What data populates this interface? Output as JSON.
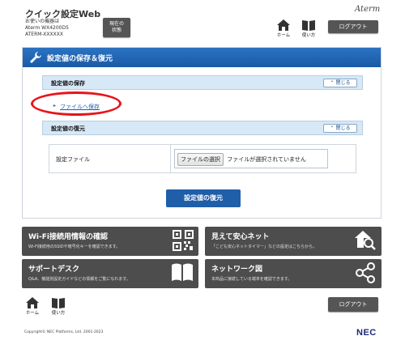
{
  "header": {
    "app_title": "クイック設定Web",
    "device_line1": "お使いの機器は",
    "device_line2": "Aterm  WX4200D5",
    "device_line3": "ATERM-XXXXXX",
    "status_button_line1": "現在の",
    "status_button_line2": "状態",
    "brand": "Aterm",
    "home_label": "ホーム",
    "usage_label": "使い方",
    "logout_label": "ログアウト"
  },
  "main": {
    "section_title": "設定値の保存＆復元",
    "save_section": {
      "label": "設定値の保存",
      "close_label": "閉じる",
      "link_text": "ファイルへ保存"
    },
    "restore_section": {
      "label": "設定値の復元",
      "close_label": "閉じる"
    },
    "file_row": {
      "label": "設定ファイル",
      "choose_button": "ファイルの選択",
      "status": "ファイルが選択されていません"
    },
    "restore_button": "設定値の復元"
  },
  "tiles": [
    {
      "title": "Wi-Fi接続用情報の確認",
      "desc": "Wi-Fi接続用のSSIDや暗号化キーを確認できます。",
      "icon": "qr-code-icon"
    },
    {
      "title": "見えて安心ネット",
      "desc": "「こども安心ネットタイマー」などの設定はこちらから。",
      "icon": "house-search-icon"
    },
    {
      "title": "サポートデスク",
      "desc": "Q&A、機能別設定ガイドなどの情報をご覧になれます。",
      "icon": "book-icon"
    },
    {
      "title": "ネットワーク図",
      "desc": "本商品に接続している端末を確認できます。",
      "icon": "network-icon"
    }
  ],
  "footer": {
    "home_label": "ホーム",
    "usage_label": "使い方",
    "logout_label": "ログアウト",
    "copyright": "Copyright© NEC Platforms, Ltd. 2001-2023",
    "nec": "NEC"
  },
  "colors": {
    "accent_blue": "#1f5ea8",
    "dark_tile": "#4d4d4d",
    "highlight_red": "#e8141b"
  }
}
